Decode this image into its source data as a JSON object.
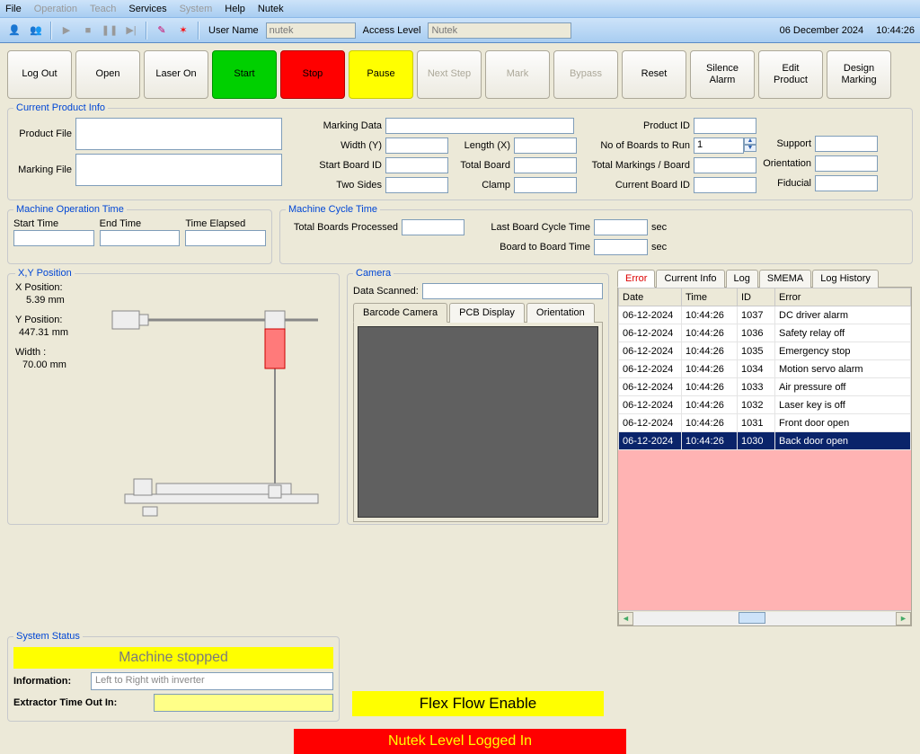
{
  "menubar": [
    "File",
    "Operation",
    "Teach",
    "Services",
    "System",
    "Help",
    "Nutek"
  ],
  "menubar_disabled": [
    false,
    true,
    true,
    false,
    true,
    false,
    false
  ],
  "toolbar": {
    "user_label": "User Name",
    "user_value": "nutek",
    "access_label": "Access Level",
    "access_value": "Nutek",
    "date": "06 December 2024",
    "clock": "10:44:26"
  },
  "buttons": {
    "logout": "Log Out",
    "open": "Open",
    "laser_on": "Laser On",
    "start": "Start",
    "stop": "Stop",
    "pause": "Pause",
    "next_step": "Next Step",
    "mark": "Mark",
    "bypass": "Bypass",
    "reset": "Reset",
    "silence": "Silence\nAlarm",
    "edit_product": "Edit\nProduct",
    "design_marking": "Design\nMarking"
  },
  "cpi": {
    "legend": "Current Product Info",
    "product_file": "Product File",
    "marking_file": "Marking File",
    "marking_data": "Marking Data",
    "width_y": "Width (Y)",
    "length_x": "Length (X)",
    "start_board_id": "Start Board ID",
    "total_board": "Total Board",
    "two_sides": "Two Sides",
    "clamp": "Clamp",
    "product_id": "Product ID",
    "no_boards": "No of Boards to Run",
    "no_boards_value": "1",
    "total_markings": "Total Markings / Board",
    "current_board_id": "Current Board ID",
    "support": "Support",
    "orientation": "Orientation",
    "fiducial": "Fiducial"
  },
  "mot": {
    "legend": "Machine Operation Time",
    "start_time": "Start Time",
    "end_time": "End Time",
    "time_elapsed": "Time Elapsed"
  },
  "mct": {
    "legend": "Machine Cycle Time",
    "total_boards": "Total Boards Processed",
    "last_cycle": "Last Board Cycle Time",
    "b2b": "Board to Board Time",
    "unit": "sec"
  },
  "xy": {
    "legend": "X,Y Position",
    "x_label": "X Position:",
    "x_value": "5.39  mm",
    "y_label": "Y Position:",
    "y_value": "447.31  mm",
    "w_label": "Width :",
    "w_value": "70.00  mm"
  },
  "camera": {
    "legend": "Camera",
    "data_scanned": "Data Scanned:",
    "tabs": [
      "Barcode Camera",
      "PCB Display",
      "Orientation"
    ]
  },
  "log": {
    "tabs": [
      "Error",
      "Current Info",
      "Log",
      "SMEMA",
      "Log History"
    ],
    "headers": [
      "Date",
      "Time",
      "ID",
      "Error"
    ],
    "rows": [
      {
        "date": "06-12-2024",
        "time": "10:44:26",
        "id": "1037",
        "err": "DC driver alarm"
      },
      {
        "date": "06-12-2024",
        "time": "10:44:26",
        "id": "1036",
        "err": "Safety relay off"
      },
      {
        "date": "06-12-2024",
        "time": "10:44:26",
        "id": "1035",
        "err": "Emergency stop"
      },
      {
        "date": "06-12-2024",
        "time": "10:44:26",
        "id": "1034",
        "err": "Motion servo alarm"
      },
      {
        "date": "06-12-2024",
        "time": "10:44:26",
        "id": "1033",
        "err": "Air pressure off"
      },
      {
        "date": "06-12-2024",
        "time": "10:44:26",
        "id": "1032",
        "err": "Laser key is off"
      },
      {
        "date": "06-12-2024",
        "time": "10:44:26",
        "id": "1031",
        "err": "Front door open"
      },
      {
        "date": "06-12-2024",
        "time": "10:44:26",
        "id": "1030",
        "err": "Back door open"
      }
    ],
    "selected": 7
  },
  "status": {
    "legend": "System Status",
    "machine": "Machine stopped",
    "info_label": "Information:",
    "info_value": "Left to Right with inverter",
    "extractor_label": "Extractor Time Out In:"
  },
  "flex_flow": "Flex Flow Enable",
  "login_bar": "Nutek Level Logged In"
}
